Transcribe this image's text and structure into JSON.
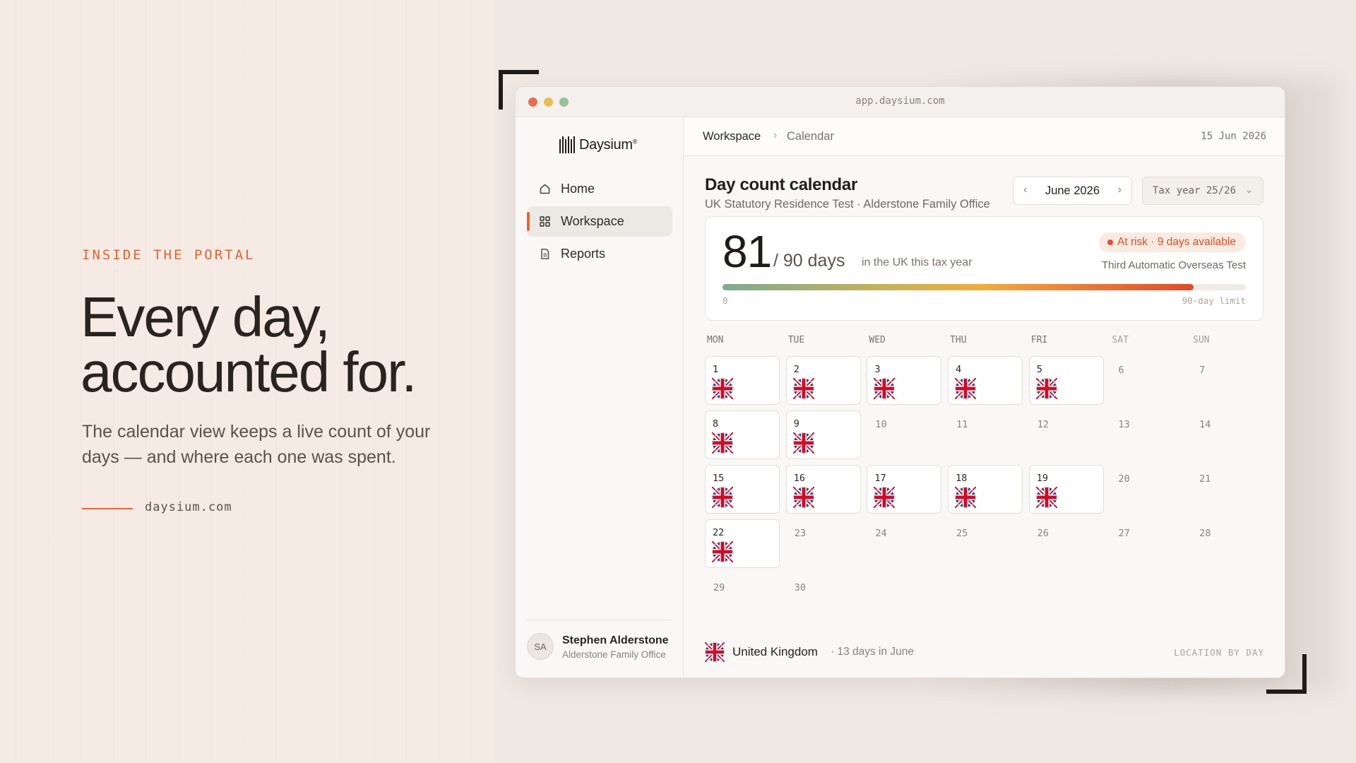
{
  "hero": {
    "eyebrow": "INSIDE THE PORTAL",
    "headline_line1": "Every day,",
    "headline_line2": "accounted for.",
    "lede": "The calendar view keeps a live count of your days — and where each one was spent.",
    "site": "daysium.com"
  },
  "window": {
    "url": "app.daysium.com"
  },
  "sidebar": {
    "brand": "Daysium",
    "brand_mark": "®",
    "nav": [
      {
        "label": "Home",
        "icon": "home-icon",
        "active": false
      },
      {
        "label": "Workspace",
        "icon": "grid-icon",
        "active": true
      },
      {
        "label": "Reports",
        "icon": "document-icon",
        "active": false
      }
    ],
    "user": {
      "initials": "SA",
      "name": "Stephen Alderstone",
      "org": "Alderstone Family Office"
    }
  },
  "topbar": {
    "crumbs": [
      "Workspace",
      "Calendar"
    ],
    "date": "15 Jun 2026"
  },
  "header": {
    "title": "Day count calendar",
    "subtitle": "UK Statutory Residence Test · Alderstone Family Office",
    "month": "June 2026",
    "tax_year": "Tax year 25/26"
  },
  "count": {
    "days": "81",
    "of": "/ 90 days",
    "note": "in the UK this tax year",
    "risk": "At risk · 9 days available",
    "test": "Third Automatic Overseas Test",
    "progress": 0.9,
    "scale_min": "0",
    "scale_max": "90-day limit",
    "colors": {
      "risk": "#e0532f",
      "accent": "#e0673b"
    }
  },
  "calendar": {
    "weekdays": [
      "MON",
      "TUE",
      "WED",
      "THU",
      "FRI",
      "SAT",
      "SUN"
    ],
    "weeks": [
      [
        {
          "d": "1",
          "uk": true
        },
        {
          "d": "2",
          "uk": true
        },
        {
          "d": "3",
          "uk": true
        },
        {
          "d": "4",
          "uk": true
        },
        {
          "d": "5",
          "uk": true
        },
        {
          "d": "6",
          "uk": false
        },
        {
          "d": "7",
          "uk": false
        }
      ],
      [
        {
          "d": "8",
          "uk": true
        },
        {
          "d": "9",
          "uk": true
        },
        {
          "d": "10",
          "uk": false
        },
        {
          "d": "11",
          "uk": false
        },
        {
          "d": "12",
          "uk": false
        },
        {
          "d": "13",
          "uk": false
        },
        {
          "d": "14",
          "uk": false
        }
      ],
      [
        {
          "d": "15",
          "uk": true
        },
        {
          "d": "16",
          "uk": true
        },
        {
          "d": "17",
          "uk": true
        },
        {
          "d": "18",
          "uk": true
        },
        {
          "d": "19",
          "uk": true
        },
        {
          "d": "20",
          "uk": false
        },
        {
          "d": "21",
          "uk": false
        }
      ],
      [
        {
          "d": "22",
          "uk": true
        },
        {
          "d": "23",
          "uk": false
        },
        {
          "d": "24",
          "uk": false
        },
        {
          "d": "25",
          "uk": false
        },
        {
          "d": "26",
          "uk": false
        },
        {
          "d": "27",
          "uk": false
        },
        {
          "d": "28",
          "uk": false
        }
      ],
      [
        {
          "d": "29",
          "uk": false
        },
        {
          "d": "30",
          "uk": false
        }
      ]
    ]
  },
  "footer": {
    "country": "United Kingdom",
    "count": "· 13 days in June",
    "right": "LOCATION BY DAY",
    "flag_icon": "uk-flag-icon"
  }
}
